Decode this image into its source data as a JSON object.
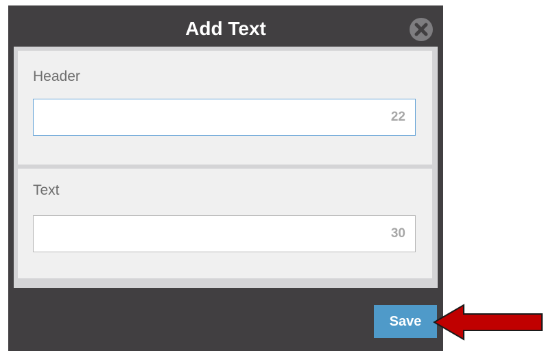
{
  "dialog": {
    "title": "Add Text",
    "close_icon": "close-circle-icon"
  },
  "fields": [
    {
      "label": "Header",
      "value": "",
      "counter": "22"
    },
    {
      "label": "Text",
      "value": "",
      "counter": "30"
    }
  ],
  "actions": {
    "save_label": "Save"
  },
  "annotation": {
    "arrow_icon": "arrow-left-icon",
    "arrow_color": "#c00000"
  },
  "colors": {
    "dialog_background": "#413f41",
    "save_button": "#4f9ac9"
  }
}
